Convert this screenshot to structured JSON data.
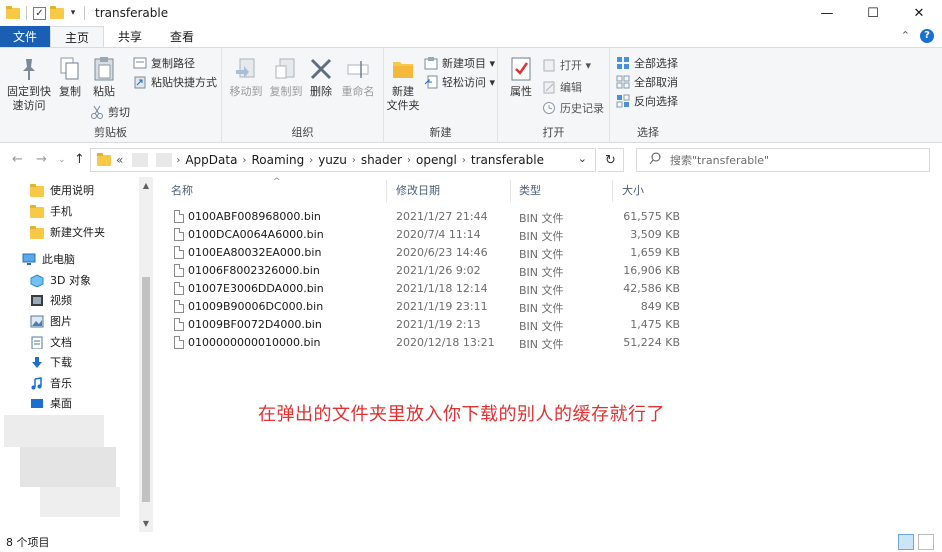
{
  "window": {
    "title": "transferable",
    "minimize": "—",
    "maximize": "☐",
    "close": "✕"
  },
  "tabs": {
    "file": "文件",
    "home": "主页",
    "share": "共享",
    "view": "查看"
  },
  "ribbon": {
    "clipboard": {
      "label": "剪贴板",
      "pin": "固定到快\n速访问",
      "pin_line1": "固定到快",
      "pin_line2": "速访问",
      "copy": "复制",
      "paste": "粘贴",
      "copy_path": "复制路径",
      "paste_shortcut": "粘贴快捷方式",
      "cut": "剪切"
    },
    "organize": {
      "label": "组织",
      "move_to": "移动到",
      "copy_to": "复制到",
      "delete": "删除",
      "rename": "重命名"
    },
    "new": {
      "label": "新建",
      "new_folder_line1": "新建",
      "new_folder_line2": "文件夹",
      "new_item": "新建项目 ▾",
      "easy_access": "轻松访问 ▾"
    },
    "open": {
      "label": "打开",
      "properties": "属性",
      "open": "打开 ▾",
      "edit": "编辑",
      "history": "历史记录"
    },
    "select": {
      "label": "选择",
      "select_all": "全部选择",
      "select_none": "全部取消",
      "invert": "反向选择"
    }
  },
  "address": {
    "prefix": "«",
    "crumbs": [
      "AppData",
      "Roaming",
      "yuzu",
      "shader",
      "opengl",
      "transferable"
    ],
    "search_placeholder": "搜索\"transferable\""
  },
  "navpane": {
    "items": [
      {
        "label": "使用说明",
        "icon": "folder-icon"
      },
      {
        "label": "手机",
        "icon": "folder-icon"
      },
      {
        "label": "新建文件夹",
        "icon": "folder-icon"
      },
      {
        "label": "此电脑",
        "icon": "computer-icon"
      },
      {
        "label": "3D 对象",
        "icon": "3d-objects-icon"
      },
      {
        "label": "视频",
        "icon": "video-icon"
      },
      {
        "label": "图片",
        "icon": "pictures-icon"
      },
      {
        "label": "文档",
        "icon": "documents-icon"
      },
      {
        "label": "下载",
        "icon": "download-icon"
      },
      {
        "label": "音乐",
        "icon": "music-icon"
      },
      {
        "label": "桌面",
        "icon": "desktop-icon"
      }
    ]
  },
  "columns": {
    "name": "名称",
    "modified": "修改日期",
    "type": "类型",
    "size": "大小"
  },
  "files": [
    {
      "name": "0100ABF008968000.bin",
      "modified": "2021/1/27 21:44",
      "type": "BIN 文件",
      "size": "61,575 KB"
    },
    {
      "name": "0100DCA0064A6000.bin",
      "modified": "2020/7/4 11:14",
      "type": "BIN 文件",
      "size": "3,509 KB"
    },
    {
      "name": "0100EA80032EA000.bin",
      "modified": "2020/6/23 14:46",
      "type": "BIN 文件",
      "size": "1,659 KB"
    },
    {
      "name": "01006F8002326000.bin",
      "modified": "2021/1/26 9:02",
      "type": "BIN 文件",
      "size": "16,906 KB"
    },
    {
      "name": "01007E3006DDA000.bin",
      "modified": "2021/1/18 12:14",
      "type": "BIN 文件",
      "size": "42,586 KB"
    },
    {
      "name": "01009B90006DC000.bin",
      "modified": "2021/1/19 23:11",
      "type": "BIN 文件",
      "size": "849 KB"
    },
    {
      "name": "01009BF0072D4000.bin",
      "modified": "2021/1/19 2:13",
      "type": "BIN 文件",
      "size": "1,475 KB"
    },
    {
      "name": "0100000000010000.bin",
      "modified": "2020/12/18 13:21",
      "type": "BIN 文件",
      "size": "51,224 KB"
    }
  ],
  "annotation": "在弹出的文件夹里放入你下载的别人的缓存就行了",
  "status": {
    "item_count": "8 个项目"
  },
  "colors": {
    "file_tab": "#1a5fb4",
    "annotation": "#e03131",
    "folder": "#f8c847"
  }
}
